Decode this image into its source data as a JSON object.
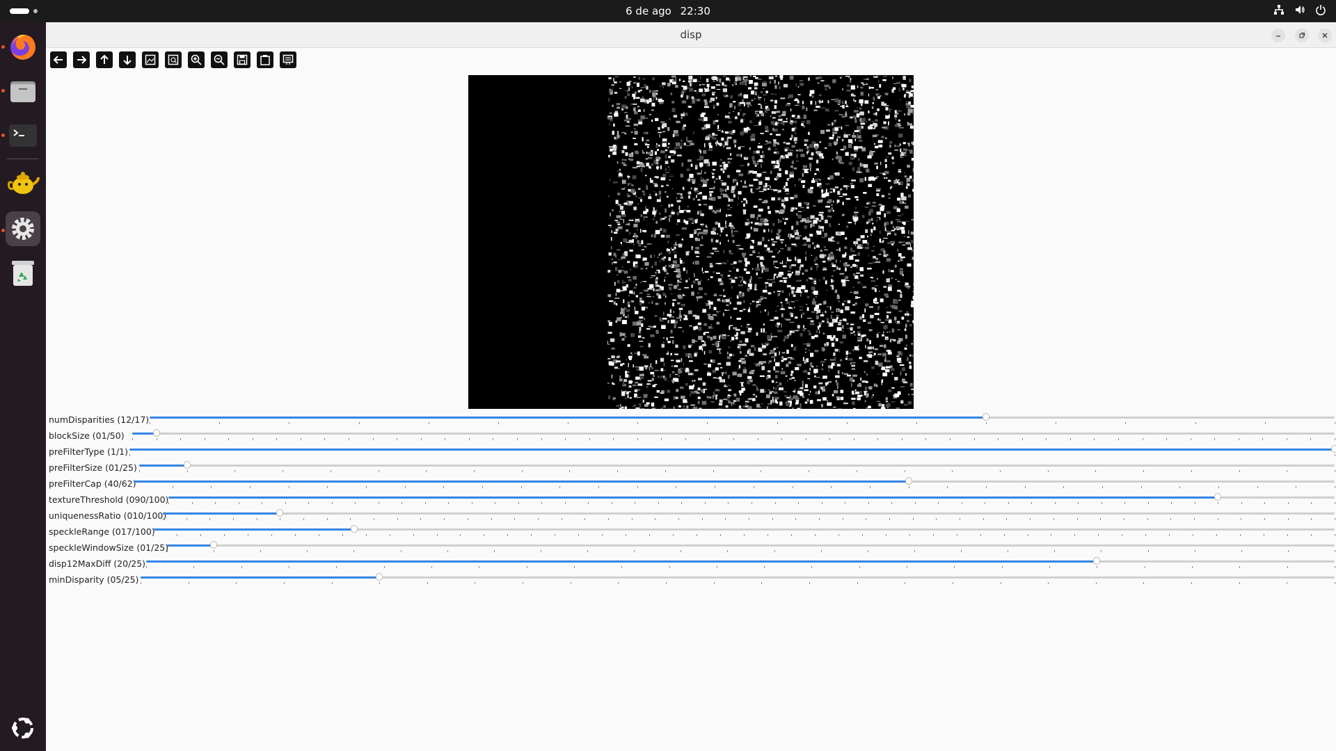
{
  "topbar": {
    "date": "6 de ago",
    "time": "22:30",
    "icons": [
      "network-icon",
      "volume-icon",
      "power-icon"
    ]
  },
  "dock": {
    "items": [
      {
        "name": "firefox",
        "icon": "firefox-icon",
        "running": true
      },
      {
        "name": "files",
        "icon": "folder-icon",
        "running": true
      },
      {
        "name": "terminal",
        "icon": "terminal-icon",
        "running": true
      },
      {
        "name": "teapot-app",
        "icon": "teapot-icon",
        "running": false
      },
      {
        "name": "settings",
        "icon": "gear-icon",
        "running": true,
        "active": true
      },
      {
        "name": "trash",
        "icon": "trash-icon",
        "running": false
      }
    ],
    "apps_icon": "ubuntu-logo-icon"
  },
  "window": {
    "title": "disp",
    "controls": [
      "minimize-icon",
      "maximize-icon",
      "close-icon"
    ]
  },
  "toolbar": {
    "buttons": [
      "arrow-left-icon",
      "arrow-right-icon",
      "arrow-up-icon",
      "arrow-down-icon",
      "image-icon",
      "image-zoom-icon",
      "zoom-in-icon",
      "zoom-out-icon",
      "save-icon",
      "clipboard-icon",
      "properties-icon"
    ]
  },
  "sliders": [
    {
      "label": "numDisparities (12/17)",
      "value": 12,
      "max": 17
    },
    {
      "label": "blockSize  (01/50)",
      "value": 1,
      "max": 50
    },
    {
      "label": "preFilterType (1/1)",
      "value": 1,
      "max": 1
    },
    {
      "label": "preFilterSize (01/25)",
      "value": 1,
      "max": 25
    },
    {
      "label": "preFilterCap (40/62)",
      "value": 40,
      "max": 62
    },
    {
      "label": "textureThreshold (090/100)",
      "value": 90,
      "max": 100
    },
    {
      "label": "uniquenessRatio (010/100)",
      "value": 10,
      "max": 100
    },
    {
      "label": "speckleRange (017/100)",
      "value": 17,
      "max": 100
    },
    {
      "label": "speckleWindowSize (01/25)",
      "value": 1,
      "max": 25
    },
    {
      "label": "disp12MaxDiff (20/25)",
      "value": 20,
      "max": 25
    },
    {
      "label": "minDisparity (05/25)",
      "value": 5,
      "max": 25
    }
  ],
  "colors": {
    "accent": "#3584e4",
    "dock": "#241a22",
    "topbar": "#1b1b1b"
  }
}
